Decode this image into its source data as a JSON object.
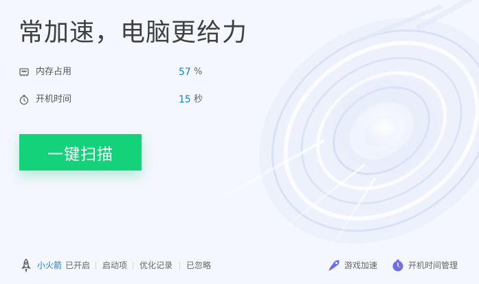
{
  "header": {
    "title": "常加速，电脑更给力"
  },
  "stats": [
    {
      "label": "内存占用",
      "value": "57",
      "unit": "%",
      "icon": "memory-chip-icon"
    },
    {
      "label": "开机时间",
      "value": "15",
      "unit": "秒",
      "icon": "stopwatch-icon"
    }
  ],
  "scan_button": {
    "label": "一键扫描"
  },
  "footer": {
    "rocket": {
      "name": "小火箭",
      "status": "已开启",
      "icon": "rocket-icon"
    },
    "links": [
      "启动项",
      "优化记录",
      "已忽略"
    ],
    "tools": [
      {
        "label": "游戏加速",
        "icon": "game-boost-icon"
      },
      {
        "label": "开机时间管理",
        "icon": "boot-time-icon"
      }
    ]
  },
  "colors": {
    "background": "#f4f7fd",
    "accent_green": "#13d27a",
    "value_blue": "#1a7bd6",
    "rocket_blue": "#1a7bd6",
    "tool_purple": "#6a6ef0"
  }
}
